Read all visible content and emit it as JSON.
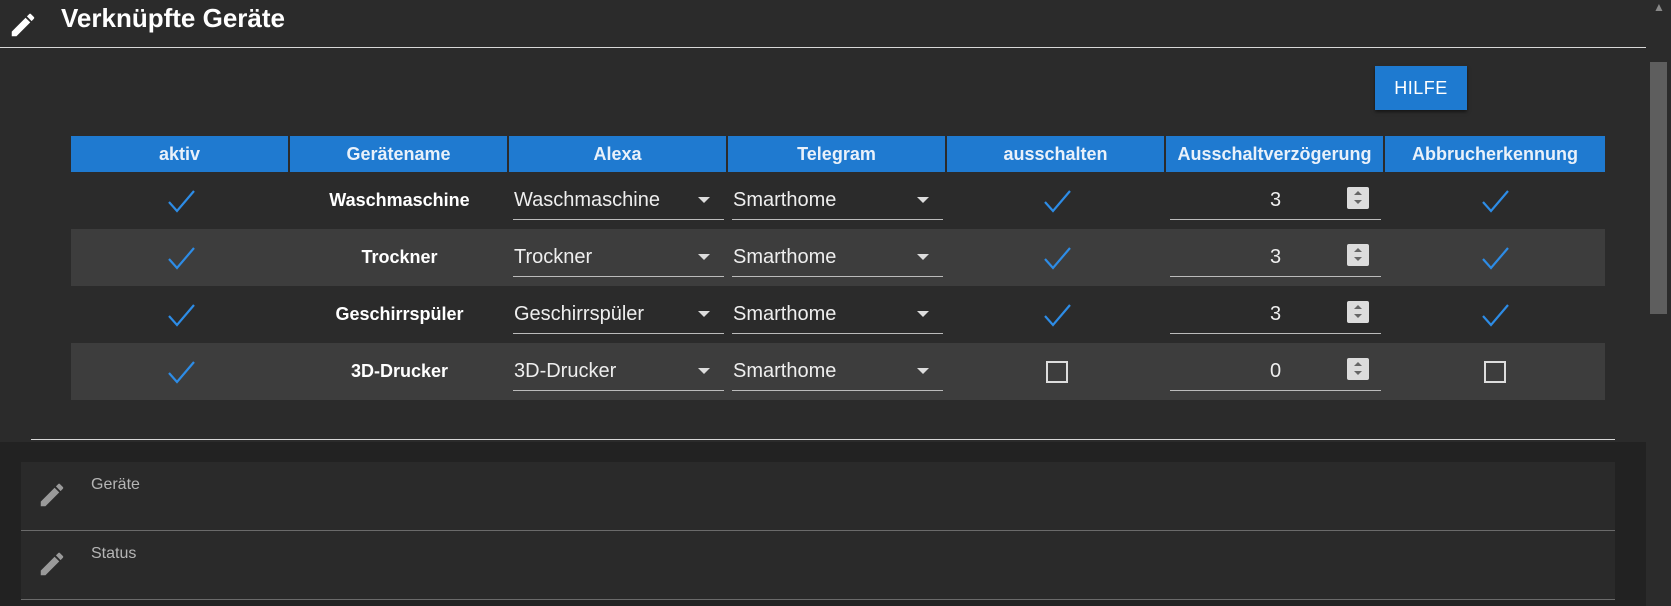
{
  "header": {
    "title": "Verknüpfte Geräte",
    "icon": "pencil-icon"
  },
  "help_button": {
    "label": "HILFE"
  },
  "table": {
    "columns": [
      "aktiv",
      "Gerätename",
      "Alexa",
      "Telegram",
      "ausschalten",
      "Ausschaltverzögerung",
      "Abbrucherkennung"
    ],
    "rows": [
      {
        "aktiv": true,
        "name": "Waschmaschine",
        "alexa": "Waschmaschine",
        "telegram": "Smarthome",
        "ausschalten": true,
        "delay": "3",
        "abbruch": true
      },
      {
        "aktiv": true,
        "name": "Trockner",
        "alexa": "Trockner",
        "telegram": "Smarthome",
        "ausschalten": true,
        "delay": "3",
        "abbruch": true
      },
      {
        "aktiv": true,
        "name": "Geschirrspüler",
        "alexa": "Geschirrspüler",
        "telegram": "Smarthome",
        "ausschalten": true,
        "delay": "3",
        "abbruch": true
      },
      {
        "aktiv": true,
        "name": "3D-Drucker",
        "alexa": "3D-Drucker",
        "telegram": "Smarthome",
        "ausschalten": false,
        "delay": "0",
        "abbruch": false
      }
    ]
  },
  "sections": [
    {
      "label": "Geräte",
      "icon": "pencil-icon"
    },
    {
      "label": "Status",
      "icon": "pencil-icon"
    }
  ],
  "colors": {
    "accent": "#1f7ad0",
    "check": "#2d8ce6",
    "background": "#2b2b2b"
  }
}
